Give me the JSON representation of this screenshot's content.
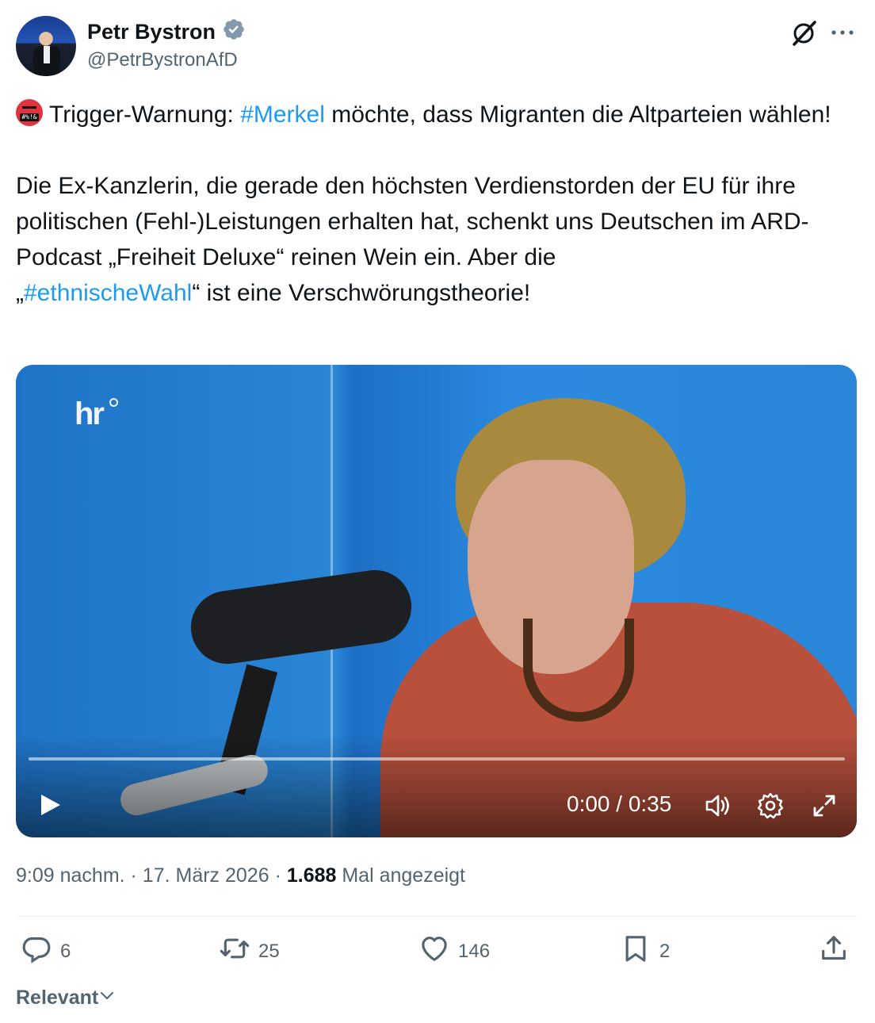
{
  "author": {
    "name": "Petr Bystron",
    "handle": "@PetrBystronAfD",
    "verified_icon": "verified-badge-icon"
  },
  "tweet": {
    "line1_prefix": "Trigger-Warnung: ",
    "hashtag1": "#Merkel",
    "line1_suffix": " möchte, dass Migranten die Altparteien wählen!",
    "para2_part1": "Die Ex-Kanzlerin, die gerade den höchsten Verdienstorden der EU für ihre politischen (Fehl-)Leistungen erhalten hat, schenkt uns Deutschen im ARD-Podcast „Freiheit Deluxe“ reinen Wein ein. Aber die",
    "para2_quote_open": "„",
    "hashtag2": "#ethnischeWahl",
    "para2_part2": "“ ist eine Verschwörungstheorie!",
    "emoji": "#%!&"
  },
  "video": {
    "logo": "hr",
    "time": "0:00 / 0:35",
    "progress": 0
  },
  "meta": {
    "time": "9:09 nachm. · 17. März 2026 · ",
    "views": "1.688",
    "views_label": " Mal angezeigt"
  },
  "actions": {
    "replies": "6",
    "reposts": "25",
    "likes": "146",
    "bookmarks": "2"
  },
  "sort": {
    "label": "Relevant"
  },
  "colors": {
    "accent": "#1d9bf0",
    "text": "#0f1419",
    "muted": "#536471"
  }
}
